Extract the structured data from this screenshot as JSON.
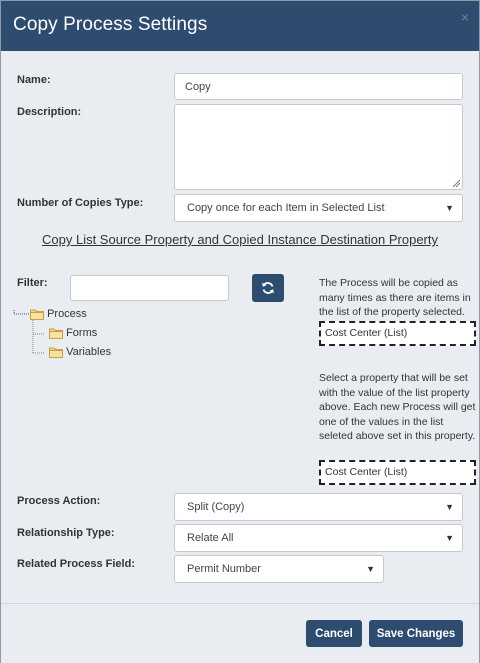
{
  "dialog": {
    "title": "Copy Process Settings",
    "close_glyph": "×"
  },
  "form": {
    "name_label": "Name:",
    "name_value": "Copy",
    "description_label": "Description:",
    "description_value": "",
    "copies_type_label": "Number of Copies Type:",
    "copies_type_value": "Copy once for each Item in Selected List",
    "section_heading": "Copy List Source Property and Copied Instance Destination Property",
    "filter_label": "Filter:",
    "filter_value": "",
    "refresh_icon": "refresh-icon",
    "tree": {
      "root": "Process",
      "children": [
        "Forms",
        "Variables"
      ]
    },
    "source_help": "The Process will be copied as many times as there are items in the list of the property selected.",
    "source_value": "Cost Center (List)",
    "destination_help": "Select a property that will be set with the value of the list property above. Each new Process will get one of the values in the list seleted above set in this property.",
    "destination_value": "Cost Center (List)",
    "process_action_label": "Process Action:",
    "process_action_value": "Split (Copy)",
    "relationship_type_label": "Relationship Type:",
    "relationship_type_value": "Relate All",
    "related_field_label": "Related Process Field:",
    "related_field_value": "Permit Number"
  },
  "footer": {
    "cancel_label": "Cancel",
    "save_label": "Save Changes"
  },
  "colors": {
    "header": "#2d4c70",
    "body": "#e9edf2",
    "button": "#2d4c70"
  }
}
